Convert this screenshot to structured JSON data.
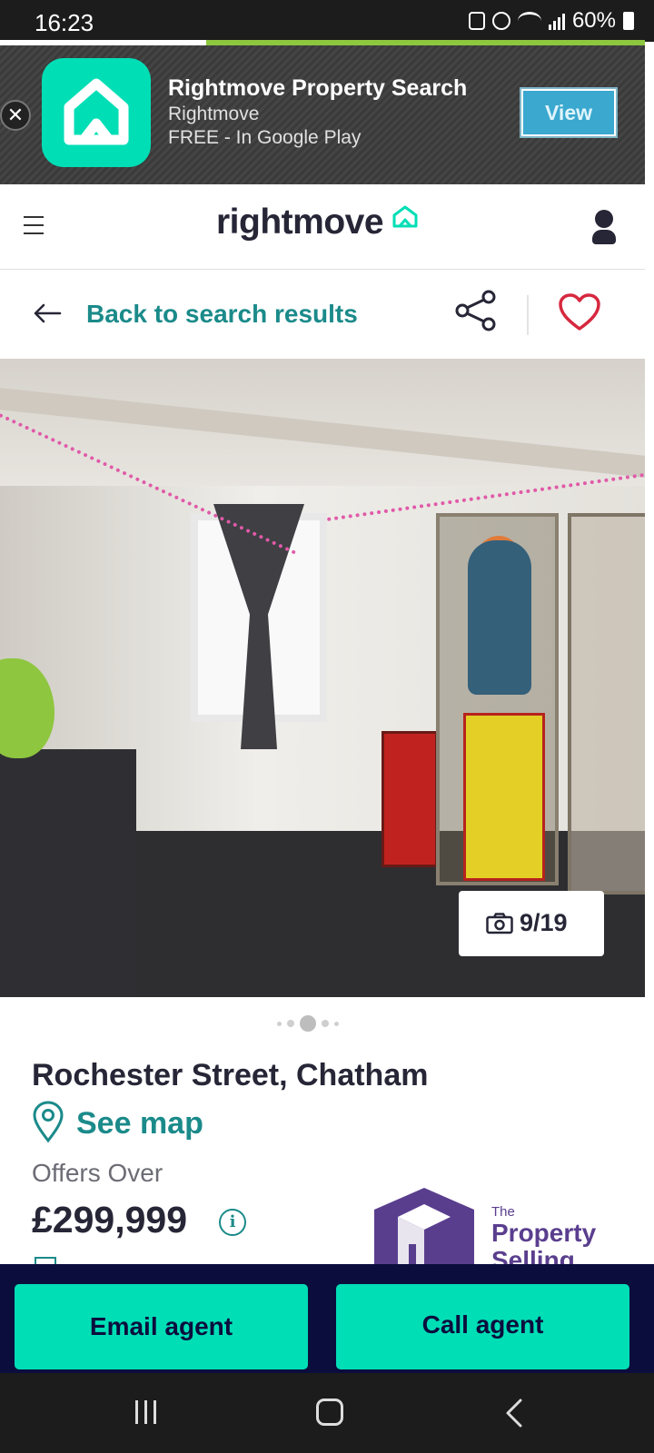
{
  "status_bar": {
    "time": "16:23",
    "battery": "60%"
  },
  "page_load_progress": 0.32,
  "app_banner": {
    "title": "Rightmove Property Search",
    "publisher": "Rightmove",
    "price_store": "FREE - In Google Play",
    "view_label": "View",
    "close_label": "✕",
    "icon": "house-icon",
    "accent_color": "#00deb6"
  },
  "header": {
    "logo_text": "rightmove",
    "menu_icon": "hamburger-icon",
    "account_icon": "user-icon"
  },
  "nav": {
    "back_label": "Back to search results",
    "share_icon": "share-icon",
    "save_icon": "heart-icon"
  },
  "gallery": {
    "counter": "9/19",
    "camera_icon": "camera-icon",
    "dot_count": 5,
    "active_dot": 2
  },
  "listing": {
    "address": "Rochester Street, Chatham",
    "see_map_label": "See map",
    "price_qualifier": "Offers Over",
    "price": "£299,999",
    "info_icon_glyph": "i",
    "agent_name_small": "The",
    "agent_name_line1": "Property",
    "agent_name_line2": "Selling"
  },
  "cta": {
    "email_label": "Email agent",
    "call_label": "Call agent",
    "bar_color": "#0b0e3d",
    "button_color": "#00deb6"
  },
  "system_nav": {
    "recents_icon": "recents-icon",
    "home_icon": "home-icon",
    "back_icon": "back-chevron-icon"
  }
}
